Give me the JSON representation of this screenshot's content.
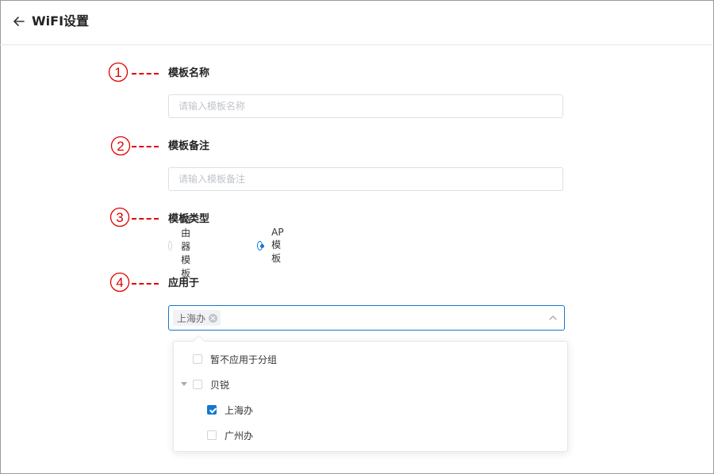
{
  "header": {
    "title": "WiFI设置"
  },
  "markers": [
    {
      "number": "1",
      "color": "#e00000"
    },
    {
      "number": "2",
      "color": "#e00000"
    },
    {
      "number": "3",
      "color": "#e00000"
    },
    {
      "number": "4",
      "color": "#e00000"
    }
  ],
  "form": {
    "name": {
      "label": "模板名称",
      "placeholder": "请输入模板名称",
      "value": ""
    },
    "note": {
      "label": "模板备注",
      "placeholder": "请输入模板备注",
      "value": ""
    },
    "type": {
      "label": "模板类型",
      "options": [
        {
          "label": "路由器模板",
          "selected": false
        },
        {
          "label": "AP模板",
          "selected": true
        }
      ]
    },
    "apply": {
      "label": "应用于",
      "selected_tags": [
        "上海办"
      ],
      "accent_color": "#1677d2",
      "dropdown": {
        "items": [
          {
            "label": "暂不应用于分组",
            "checked": false
          },
          {
            "label": "贝锐",
            "checked": false,
            "expanded": true
          },
          {
            "label": "上海办",
            "checked": true
          },
          {
            "label": "广州办",
            "checked": false
          }
        ]
      }
    }
  }
}
